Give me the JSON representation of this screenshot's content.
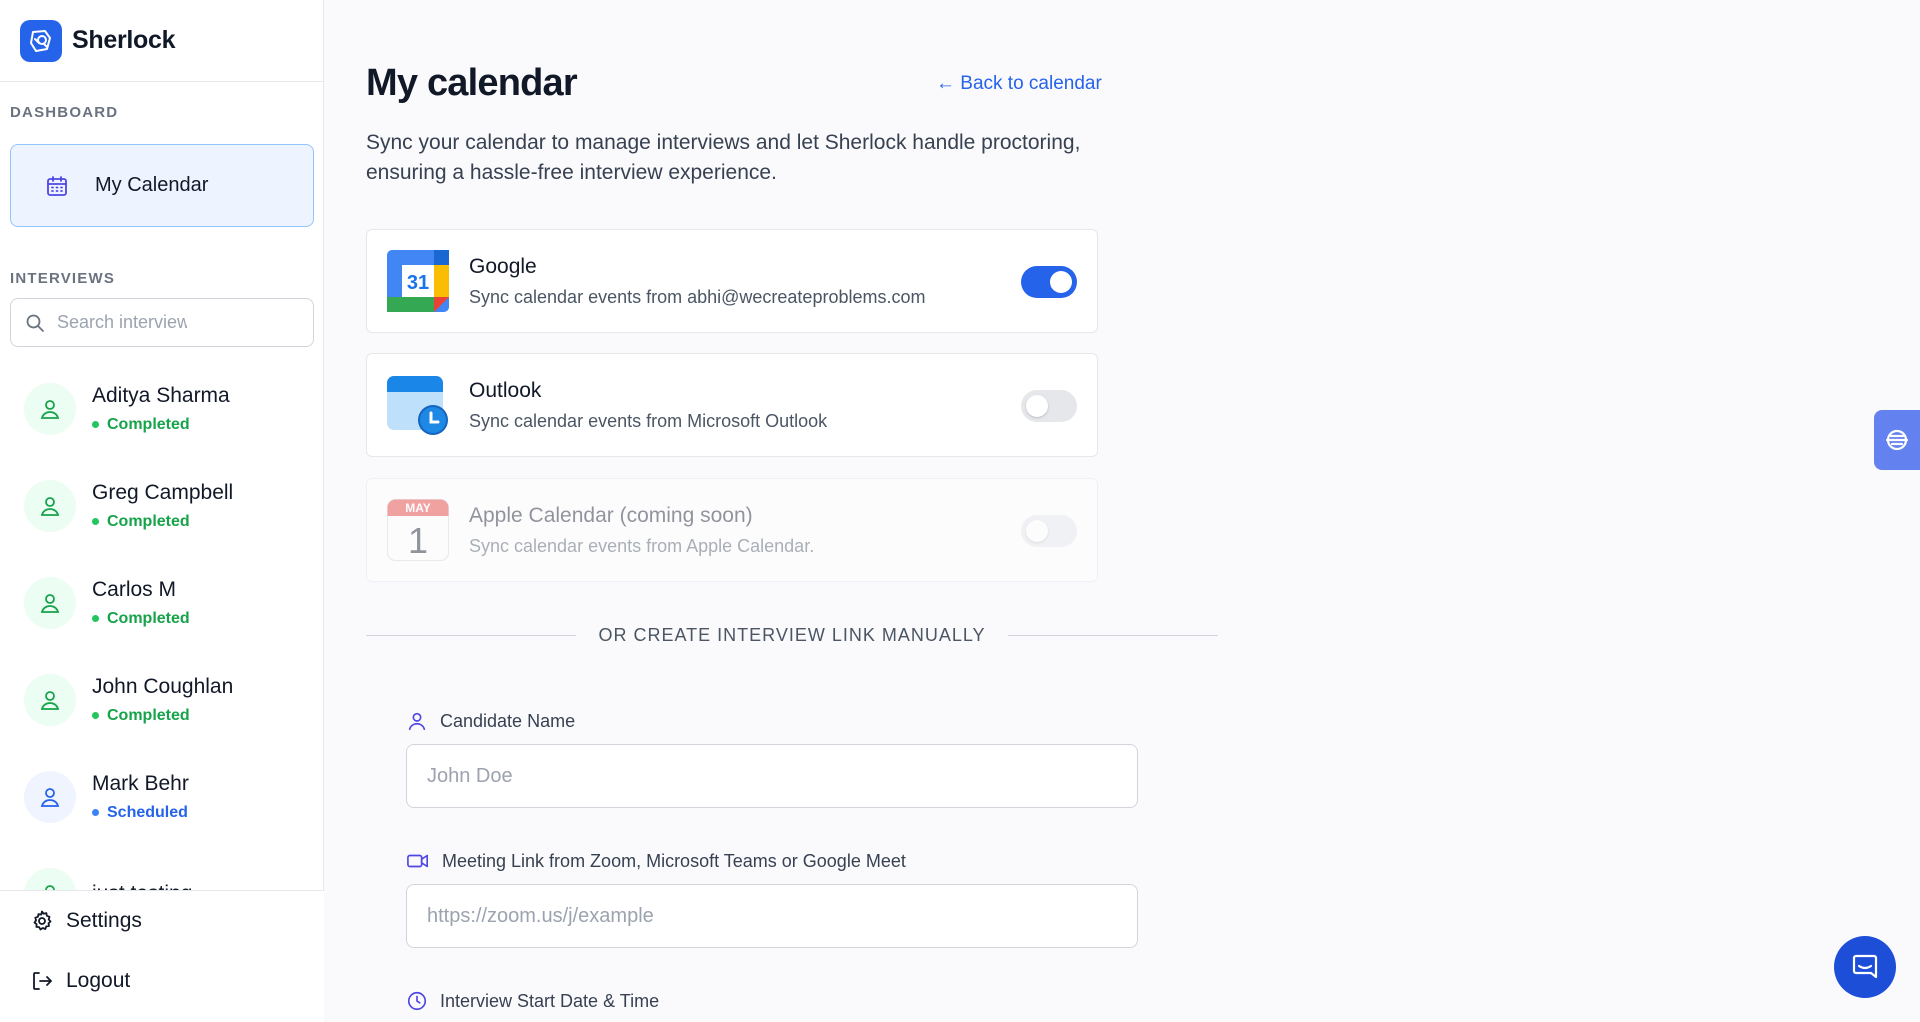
{
  "app": {
    "name": "Sherlock"
  },
  "sidebar": {
    "dashboard_label": "DASHBOARD",
    "nav_calendar": "My Calendar",
    "interviews_label": "INTERVIEWS",
    "search_placeholder": "Search interviews",
    "interviews": [
      {
        "name": "Aditya Sharma",
        "status": "Completed"
      },
      {
        "name": "Greg Campbell",
        "status": "Completed"
      },
      {
        "name": "Carlos M",
        "status": "Completed"
      },
      {
        "name": "John Coughlan",
        "status": "Completed"
      },
      {
        "name": "Mark Behr",
        "status": "Scheduled"
      },
      {
        "name": "just testing",
        "status": ""
      }
    ],
    "settings_label": "Settings",
    "logout_label": "Logout"
  },
  "main": {
    "title": "My calendar",
    "back_link": "← Back to calendar",
    "subtitle": "Sync your calendar to manage interviews and let Sherlock handle proctoring, ensuring a hassle-free interview experience.",
    "calendars": [
      {
        "title": "Google",
        "desc": "Sync calendar events from abhi@wecreateproblems.com",
        "enabled": true,
        "icon_text": "31"
      },
      {
        "title": "Outlook",
        "desc": "Sync calendar events from Microsoft Outlook",
        "enabled": false
      },
      {
        "title": "Apple Calendar (coming soon)",
        "desc": "Sync calendar events from Apple Calendar.",
        "enabled": false,
        "icon_month": "MAY",
        "icon_day": "1"
      }
    ],
    "divider_text": "OR CREATE INTERVIEW LINK MANUALLY",
    "form": {
      "candidate_label": "Candidate Name",
      "candidate_placeholder": "John Doe",
      "meeting_label": "Meeting Link from Zoom, Microsoft Teams or Google Meet",
      "meeting_placeholder": "https://zoom.us/j/example",
      "start_label": "Interview Start Date & Time"
    }
  },
  "colors": {
    "accent": "#2563eb",
    "completed": "#16a34a",
    "scheduled": "#2563eb"
  }
}
